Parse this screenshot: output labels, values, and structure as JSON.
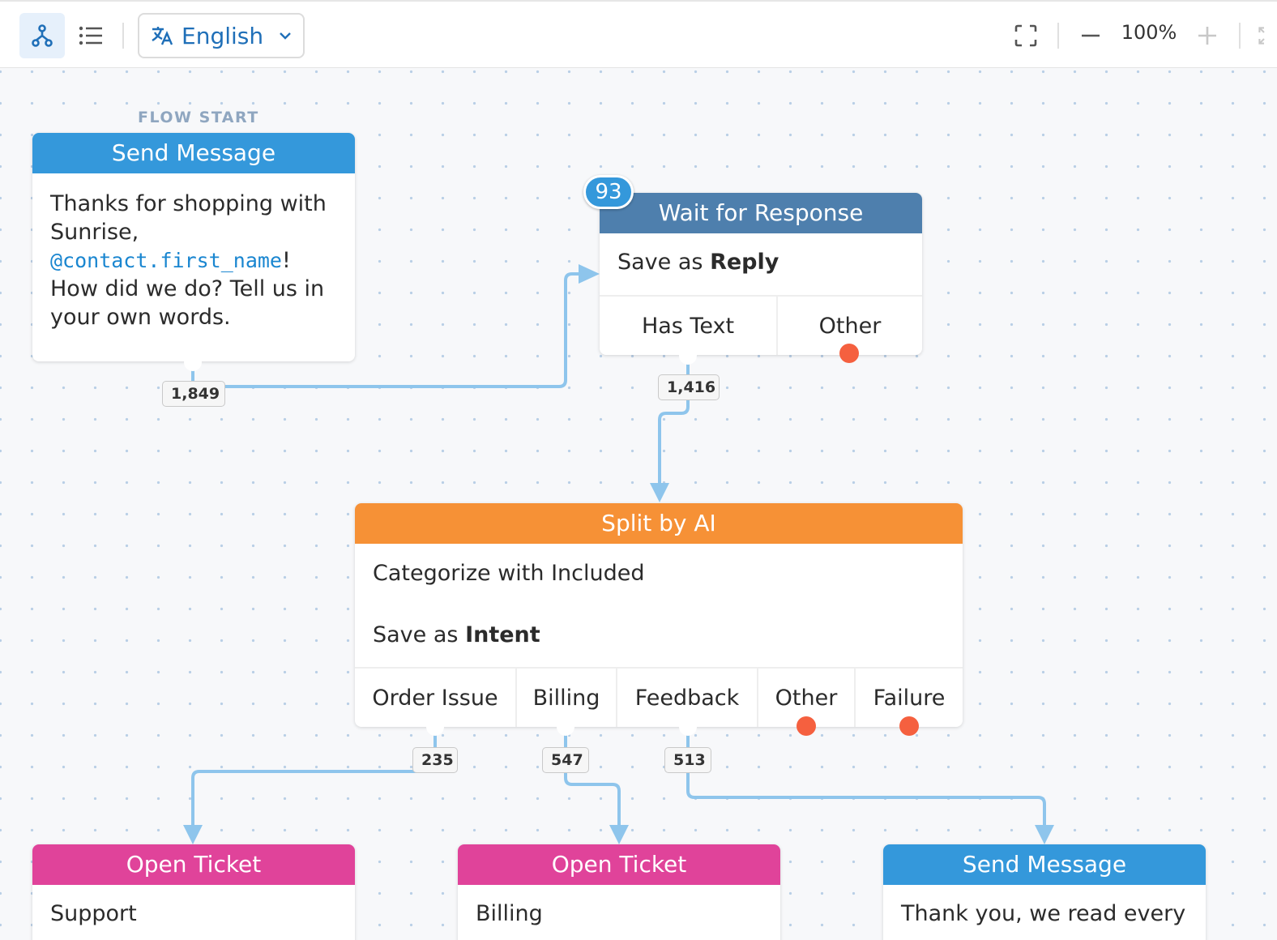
{
  "toolbar": {
    "flow_view_icon": "flow-icon",
    "list_view_icon": "list-icon",
    "language": "English",
    "language_icon": "translate-icon",
    "fullscreen_icon": "fullscreen-icon",
    "zoom_out_icon": "minus-icon",
    "zoom_level": "100%",
    "zoom_in_icon": "plus-icon"
  },
  "canvas": {
    "flow_start_label": "FLOW START",
    "nodes": {
      "send_message_1": {
        "title": "Send Message",
        "text_before": "Thanks for shopping with Sunrise, ",
        "expression": "@contact.first_name",
        "text_after": "! How did we do? Tell us in your own words.",
        "exit_count": "1,849"
      },
      "wait_for_response": {
        "active_count": "93",
        "title": "Wait for Response",
        "save_prefix": "Save as ",
        "save_name": "Reply",
        "categories": [
          "Has Text",
          "Other"
        ],
        "exit_count": "1,416"
      },
      "split_by_ai": {
        "title": "Split by AI",
        "line1": "Categorize with Included",
        "save_prefix": "Save as ",
        "save_name": "Intent",
        "categories": [
          "Order Issue",
          "Billing",
          "Feedback",
          "Other",
          "Failure"
        ],
        "exit_counts": [
          "235",
          "547",
          "513"
        ]
      },
      "open_ticket_support": {
        "title": "Open Ticket",
        "body": "Support"
      },
      "open_ticket_billing": {
        "title": "Open Ticket",
        "body": "Billing"
      },
      "send_message_2": {
        "title": "Send Message",
        "body": "Thank you, we read every"
      }
    }
  },
  "colors": {
    "send_message": "#3498db",
    "wait_for_response": "#4e7fad",
    "split_by_ai": "#f69136",
    "open_ticket": "#e0439a",
    "connector": "#8ec5ec",
    "unconnected_exit": "#f5603f",
    "accent": "#1f6fb8"
  }
}
